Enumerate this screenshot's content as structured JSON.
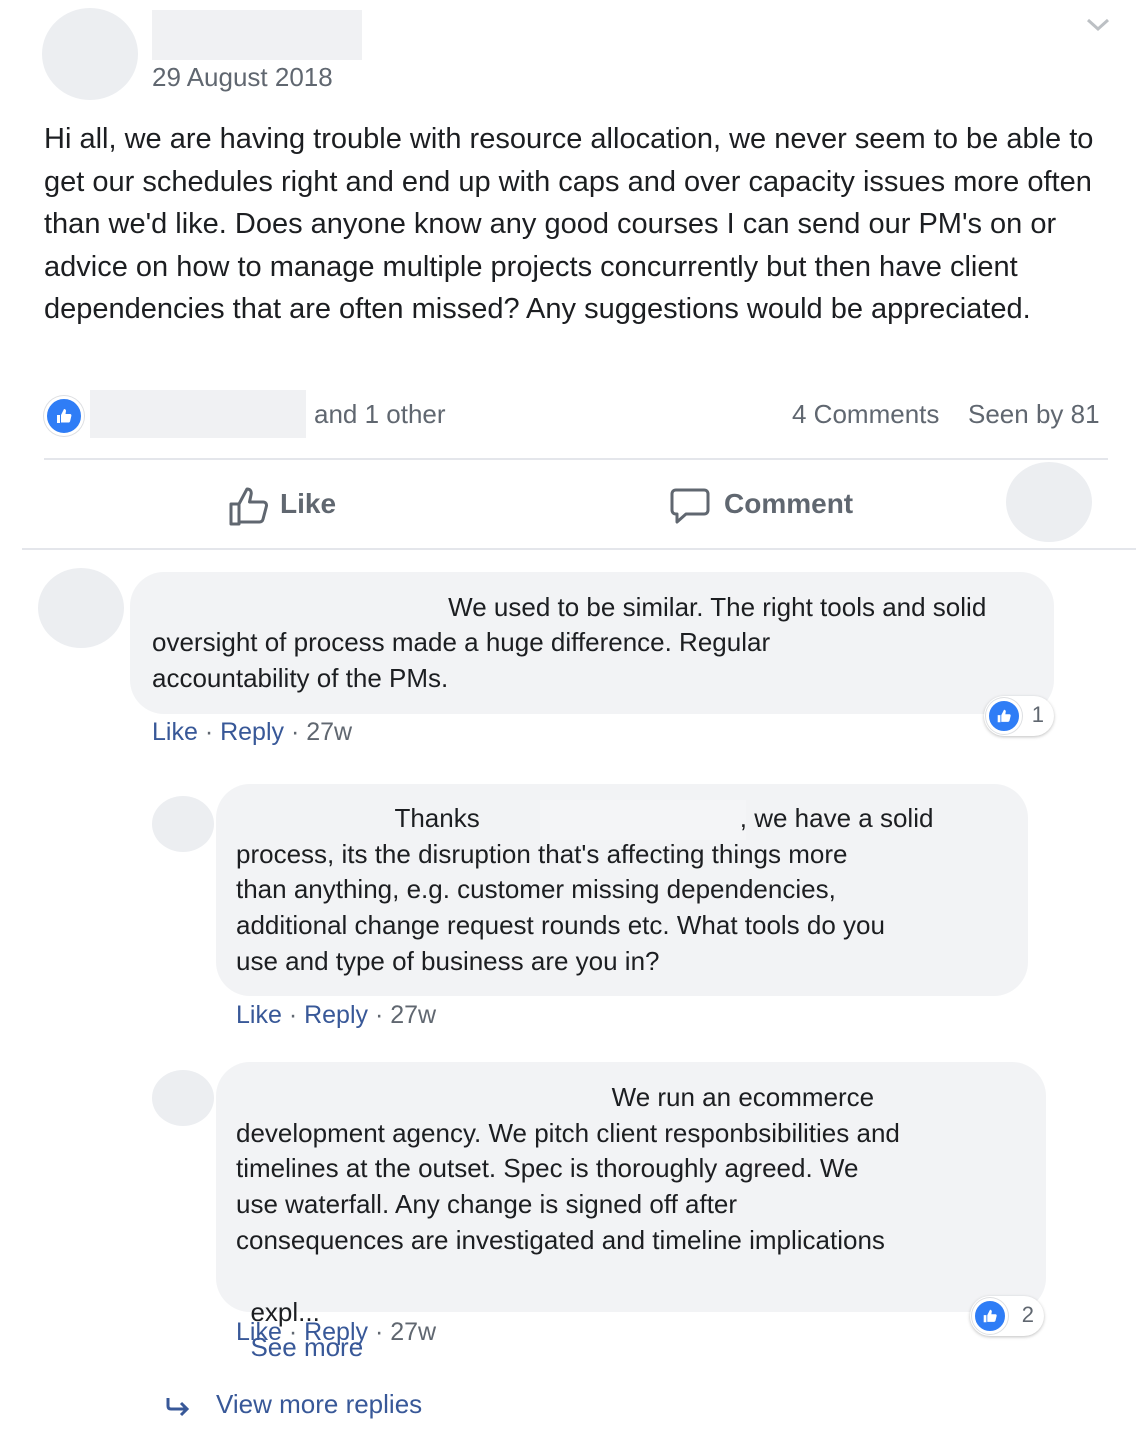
{
  "post": {
    "date": "29 August 2018",
    "text": "Hi all, we are having trouble with resource allocation, we never seem to be able to get our schedules right and end up with caps and over capacity issues more often than we'd like. Does anyone know any good courses I can send our PM's on or advice on how to manage multiple projects concurrently but then have client dependencies that are often missed? Any suggestions would be appreciated.",
    "reactions_suffix": "and 1 other",
    "comments_count": "4 Comments",
    "seen_by": "Seen by 81"
  },
  "actions": {
    "like_label": "Like",
    "comment_label": "Comment"
  },
  "comments": [
    {
      "lines": [
        "                                         We used to be similar. The right tools and solid",
        "oversight of process made a huge difference. Regular",
        "accountability of the PMs."
      ],
      "like_label": "Like",
      "reply_label": "Reply",
      "time": "27w",
      "reaction_count": "1"
    },
    {
      "lines": [
        "                      Thanks                                    , we have a solid",
        "process, its the disruption that's affecting things more",
        "than anything, e.g. customer missing dependencies,",
        "additional change request rounds etc. What tools do you",
        "use and type of business are you in?"
      ],
      "like_label": "Like",
      "reply_label": "Reply",
      "time": "27w"
    },
    {
      "lines": [
        "                                                    We run an ecommerce",
        "development agency. We pitch client responbsibilities and",
        "timelines at the outset. Spec is thoroughly agreed. We",
        "use waterfall. Any change is signed off after",
        "consequences are investigated and timeline implications"
      ],
      "last_line": "expl...",
      "see_more": "See more",
      "like_label": "Like",
      "reply_label": "Reply",
      "time": "27w",
      "reaction_count": "2"
    }
  ],
  "view_more_replies": "View more replies",
  "colors": {
    "link": "#385898",
    "like_blue": "#2f7df6",
    "bubble_bg": "#f2f3f5",
    "secondary_text": "#606770"
  },
  "icons": [
    "chevron-down-icon",
    "like-badge-icon",
    "thumbs-up-icon",
    "comment-icon",
    "reply-arrow-icon"
  ]
}
